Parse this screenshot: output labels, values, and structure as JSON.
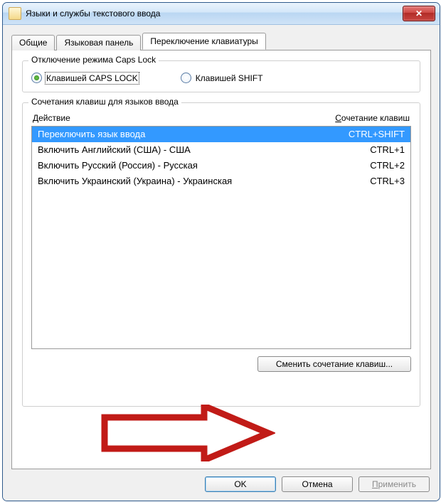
{
  "window": {
    "title": "Языки и службы текстового ввода",
    "close_glyph": "✕"
  },
  "tabs": {
    "general": "Общие",
    "langbar": "Языковая панель",
    "switching": "Переключение клавиатуры",
    "active_index": 2
  },
  "group_caps": {
    "legend": "Отключение режима Caps Lock",
    "opt_caps": "Клавишей CAPS LOCK",
    "opt_shift": "Клавишей SHIFT",
    "selected": "caps"
  },
  "group_hotkeys": {
    "legend": "Сочетания клавиш для языков ввода",
    "col_action": "Действие",
    "col_combo_prefix": "С",
    "col_combo_rest": "очетание клавиш",
    "rows": [
      {
        "action": "Переключить язык ввода",
        "combo": "CTRL+SHIFT",
        "selected": true
      },
      {
        "action": "Включить Английский (США) - США",
        "combo": "CTRL+1",
        "selected": false
      },
      {
        "action": "Включить Русский (Россия) - Русская",
        "combo": "CTRL+2",
        "selected": false
      },
      {
        "action": "Включить Украинский (Украина) - Украинская",
        "combo": "CTRL+3",
        "selected": false
      }
    ],
    "change_btn": "Сменить сочетание клавиш..."
  },
  "dialog": {
    "ok": "OK",
    "cancel": "Отмена",
    "apply_prefix": "П",
    "apply_rest": "рименить"
  },
  "colors": {
    "selection": "#3399ff",
    "arrow": "#c11b17"
  }
}
